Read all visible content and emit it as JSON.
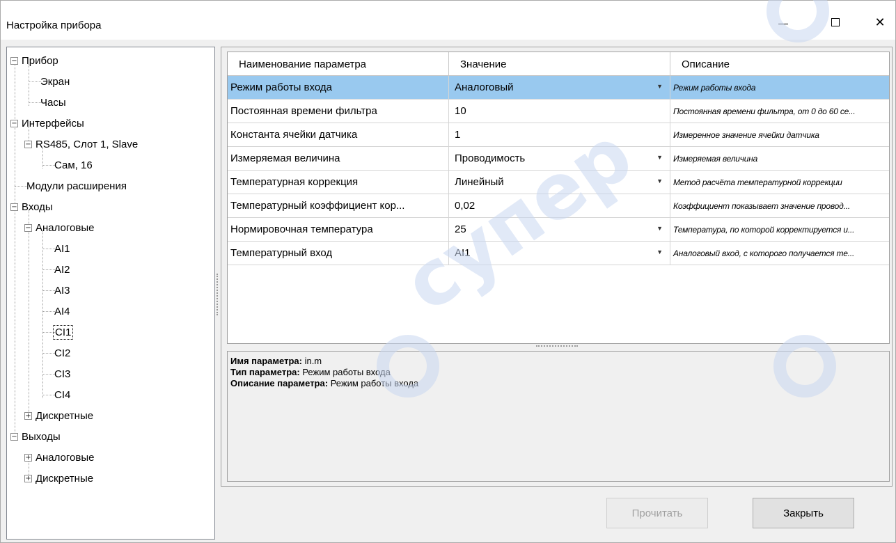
{
  "window": {
    "title": "Настройка прибора"
  },
  "tree": {
    "items": [
      {
        "label": "Прибор",
        "expander": "−"
      },
      {
        "label": "Экран"
      },
      {
        "label": "Часы"
      },
      {
        "label": "Интерфейсы",
        "expander": "−"
      },
      {
        "label": "RS485, Слот 1, Slave",
        "expander": "−"
      },
      {
        "label": "Сам, 16"
      },
      {
        "label": "Модули расширения"
      },
      {
        "label": "Входы",
        "expander": "−"
      },
      {
        "label": "Аналоговые",
        "expander": "−"
      },
      {
        "label": "AI1"
      },
      {
        "label": "AI2"
      },
      {
        "label": "AI3"
      },
      {
        "label": "AI4"
      },
      {
        "label": "CI1"
      },
      {
        "label": "CI2"
      },
      {
        "label": "CI3"
      },
      {
        "label": "CI4"
      },
      {
        "label": "Дискретные",
        "expander": "+"
      },
      {
        "label": "Выходы",
        "expander": "−"
      },
      {
        "label": "Аналоговые",
        "expander": "+"
      },
      {
        "label": "Дискретные",
        "expander": "+"
      }
    ]
  },
  "grid": {
    "columns": [
      "Наименование параметра",
      "Значение",
      "Описание"
    ],
    "rows": [
      {
        "name": "Режим работы входа",
        "value": "Аналоговый",
        "description": "Режим работы входа"
      },
      {
        "name": "Постоянная времени фильтра",
        "value": "10",
        "description": "Постоянная времени фильтра, от 0 до 60 се..."
      },
      {
        "name": "Константа ячейки датчика",
        "value": "1",
        "description": "Измеренное значение ячейки датчика"
      },
      {
        "name": "Измеряемая величина",
        "value": "Проводимость",
        "description": "Измеряемая величина"
      },
      {
        "name": "Температурная коррекция",
        "value": "Линейный",
        "description": "Метод расчёта температурной коррекции"
      },
      {
        "name": "Температурный коэффициент кор...",
        "value": "0,02",
        "description": "Коэффициент показывает значение провод..."
      },
      {
        "name": "Нормировочная температура",
        "value": "25",
        "description": "Температура, по которой корректируется и..."
      },
      {
        "name": "Температурный вход",
        "value": "AI1",
        "description": "Аналоговый вход, с которого получается те..."
      }
    ]
  },
  "details": {
    "name_label": "Имя параметра:",
    "name_value": "in.m",
    "type_label": "Тип параметра:",
    "type_value": "Режим работы входа",
    "desc_label": "Описание параметра:",
    "desc_value": "Режим работы входа"
  },
  "buttons": {
    "read": "Прочитать",
    "close": "Закрыть"
  },
  "watermark": "супер"
}
